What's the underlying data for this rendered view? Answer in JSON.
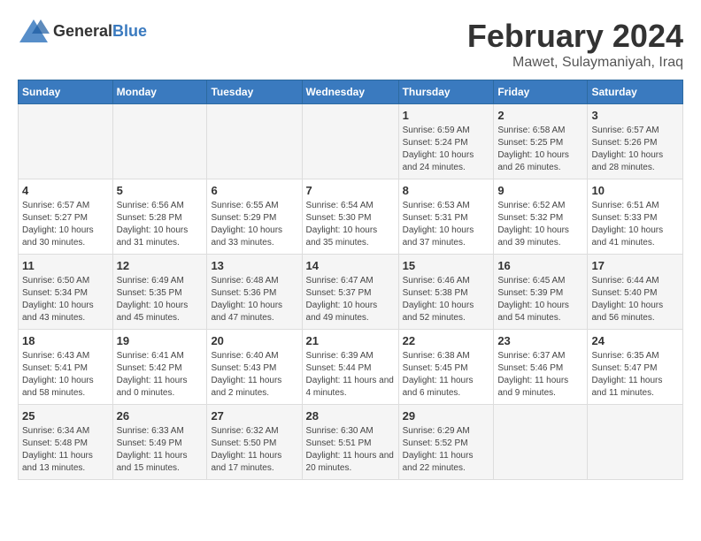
{
  "logo": {
    "general": "General",
    "blue": "Blue"
  },
  "title": "February 2024",
  "location": "Mawet, Sulaymaniyah, Iraq",
  "days_of_week": [
    "Sunday",
    "Monday",
    "Tuesday",
    "Wednesday",
    "Thursday",
    "Friday",
    "Saturday"
  ],
  "weeks": [
    [
      {
        "day": "",
        "sunrise": "",
        "sunset": "",
        "daylight": ""
      },
      {
        "day": "",
        "sunrise": "",
        "sunset": "",
        "daylight": ""
      },
      {
        "day": "",
        "sunrise": "",
        "sunset": "",
        "daylight": ""
      },
      {
        "day": "",
        "sunrise": "",
        "sunset": "",
        "daylight": ""
      },
      {
        "day": "1",
        "sunrise": "Sunrise: 6:59 AM",
        "sunset": "Sunset: 5:24 PM",
        "daylight": "Daylight: 10 hours and 24 minutes."
      },
      {
        "day": "2",
        "sunrise": "Sunrise: 6:58 AM",
        "sunset": "Sunset: 5:25 PM",
        "daylight": "Daylight: 10 hours and 26 minutes."
      },
      {
        "day": "3",
        "sunrise": "Sunrise: 6:57 AM",
        "sunset": "Sunset: 5:26 PM",
        "daylight": "Daylight: 10 hours and 28 minutes."
      }
    ],
    [
      {
        "day": "4",
        "sunrise": "Sunrise: 6:57 AM",
        "sunset": "Sunset: 5:27 PM",
        "daylight": "Daylight: 10 hours and 30 minutes."
      },
      {
        "day": "5",
        "sunrise": "Sunrise: 6:56 AM",
        "sunset": "Sunset: 5:28 PM",
        "daylight": "Daylight: 10 hours and 31 minutes."
      },
      {
        "day": "6",
        "sunrise": "Sunrise: 6:55 AM",
        "sunset": "Sunset: 5:29 PM",
        "daylight": "Daylight: 10 hours and 33 minutes."
      },
      {
        "day": "7",
        "sunrise": "Sunrise: 6:54 AM",
        "sunset": "Sunset: 5:30 PM",
        "daylight": "Daylight: 10 hours and 35 minutes."
      },
      {
        "day": "8",
        "sunrise": "Sunrise: 6:53 AM",
        "sunset": "Sunset: 5:31 PM",
        "daylight": "Daylight: 10 hours and 37 minutes."
      },
      {
        "day": "9",
        "sunrise": "Sunrise: 6:52 AM",
        "sunset": "Sunset: 5:32 PM",
        "daylight": "Daylight: 10 hours and 39 minutes."
      },
      {
        "day": "10",
        "sunrise": "Sunrise: 6:51 AM",
        "sunset": "Sunset: 5:33 PM",
        "daylight": "Daylight: 10 hours and 41 minutes."
      }
    ],
    [
      {
        "day": "11",
        "sunrise": "Sunrise: 6:50 AM",
        "sunset": "Sunset: 5:34 PM",
        "daylight": "Daylight: 10 hours and 43 minutes."
      },
      {
        "day": "12",
        "sunrise": "Sunrise: 6:49 AM",
        "sunset": "Sunset: 5:35 PM",
        "daylight": "Daylight: 10 hours and 45 minutes."
      },
      {
        "day": "13",
        "sunrise": "Sunrise: 6:48 AM",
        "sunset": "Sunset: 5:36 PM",
        "daylight": "Daylight: 10 hours and 47 minutes."
      },
      {
        "day": "14",
        "sunrise": "Sunrise: 6:47 AM",
        "sunset": "Sunset: 5:37 PM",
        "daylight": "Daylight: 10 hours and 49 minutes."
      },
      {
        "day": "15",
        "sunrise": "Sunrise: 6:46 AM",
        "sunset": "Sunset: 5:38 PM",
        "daylight": "Daylight: 10 hours and 52 minutes."
      },
      {
        "day": "16",
        "sunrise": "Sunrise: 6:45 AM",
        "sunset": "Sunset: 5:39 PM",
        "daylight": "Daylight: 10 hours and 54 minutes."
      },
      {
        "day": "17",
        "sunrise": "Sunrise: 6:44 AM",
        "sunset": "Sunset: 5:40 PM",
        "daylight": "Daylight: 10 hours and 56 minutes."
      }
    ],
    [
      {
        "day": "18",
        "sunrise": "Sunrise: 6:43 AM",
        "sunset": "Sunset: 5:41 PM",
        "daylight": "Daylight: 10 hours and 58 minutes."
      },
      {
        "day": "19",
        "sunrise": "Sunrise: 6:41 AM",
        "sunset": "Sunset: 5:42 PM",
        "daylight": "Daylight: 11 hours and 0 minutes."
      },
      {
        "day": "20",
        "sunrise": "Sunrise: 6:40 AM",
        "sunset": "Sunset: 5:43 PM",
        "daylight": "Daylight: 11 hours and 2 minutes."
      },
      {
        "day": "21",
        "sunrise": "Sunrise: 6:39 AM",
        "sunset": "Sunset: 5:44 PM",
        "daylight": "Daylight: 11 hours and 4 minutes."
      },
      {
        "day": "22",
        "sunrise": "Sunrise: 6:38 AM",
        "sunset": "Sunset: 5:45 PM",
        "daylight": "Daylight: 11 hours and 6 minutes."
      },
      {
        "day": "23",
        "sunrise": "Sunrise: 6:37 AM",
        "sunset": "Sunset: 5:46 PM",
        "daylight": "Daylight: 11 hours and 9 minutes."
      },
      {
        "day": "24",
        "sunrise": "Sunrise: 6:35 AM",
        "sunset": "Sunset: 5:47 PM",
        "daylight": "Daylight: 11 hours and 11 minutes."
      }
    ],
    [
      {
        "day": "25",
        "sunrise": "Sunrise: 6:34 AM",
        "sunset": "Sunset: 5:48 PM",
        "daylight": "Daylight: 11 hours and 13 minutes."
      },
      {
        "day": "26",
        "sunrise": "Sunrise: 6:33 AM",
        "sunset": "Sunset: 5:49 PM",
        "daylight": "Daylight: 11 hours and 15 minutes."
      },
      {
        "day": "27",
        "sunrise": "Sunrise: 6:32 AM",
        "sunset": "Sunset: 5:50 PM",
        "daylight": "Daylight: 11 hours and 17 minutes."
      },
      {
        "day": "28",
        "sunrise": "Sunrise: 6:30 AM",
        "sunset": "Sunset: 5:51 PM",
        "daylight": "Daylight: 11 hours and 20 minutes."
      },
      {
        "day": "29",
        "sunrise": "Sunrise: 6:29 AM",
        "sunset": "Sunset: 5:52 PM",
        "daylight": "Daylight: 11 hours and 22 minutes."
      },
      {
        "day": "",
        "sunrise": "",
        "sunset": "",
        "daylight": ""
      },
      {
        "day": "",
        "sunrise": "",
        "sunset": "",
        "daylight": ""
      }
    ]
  ]
}
